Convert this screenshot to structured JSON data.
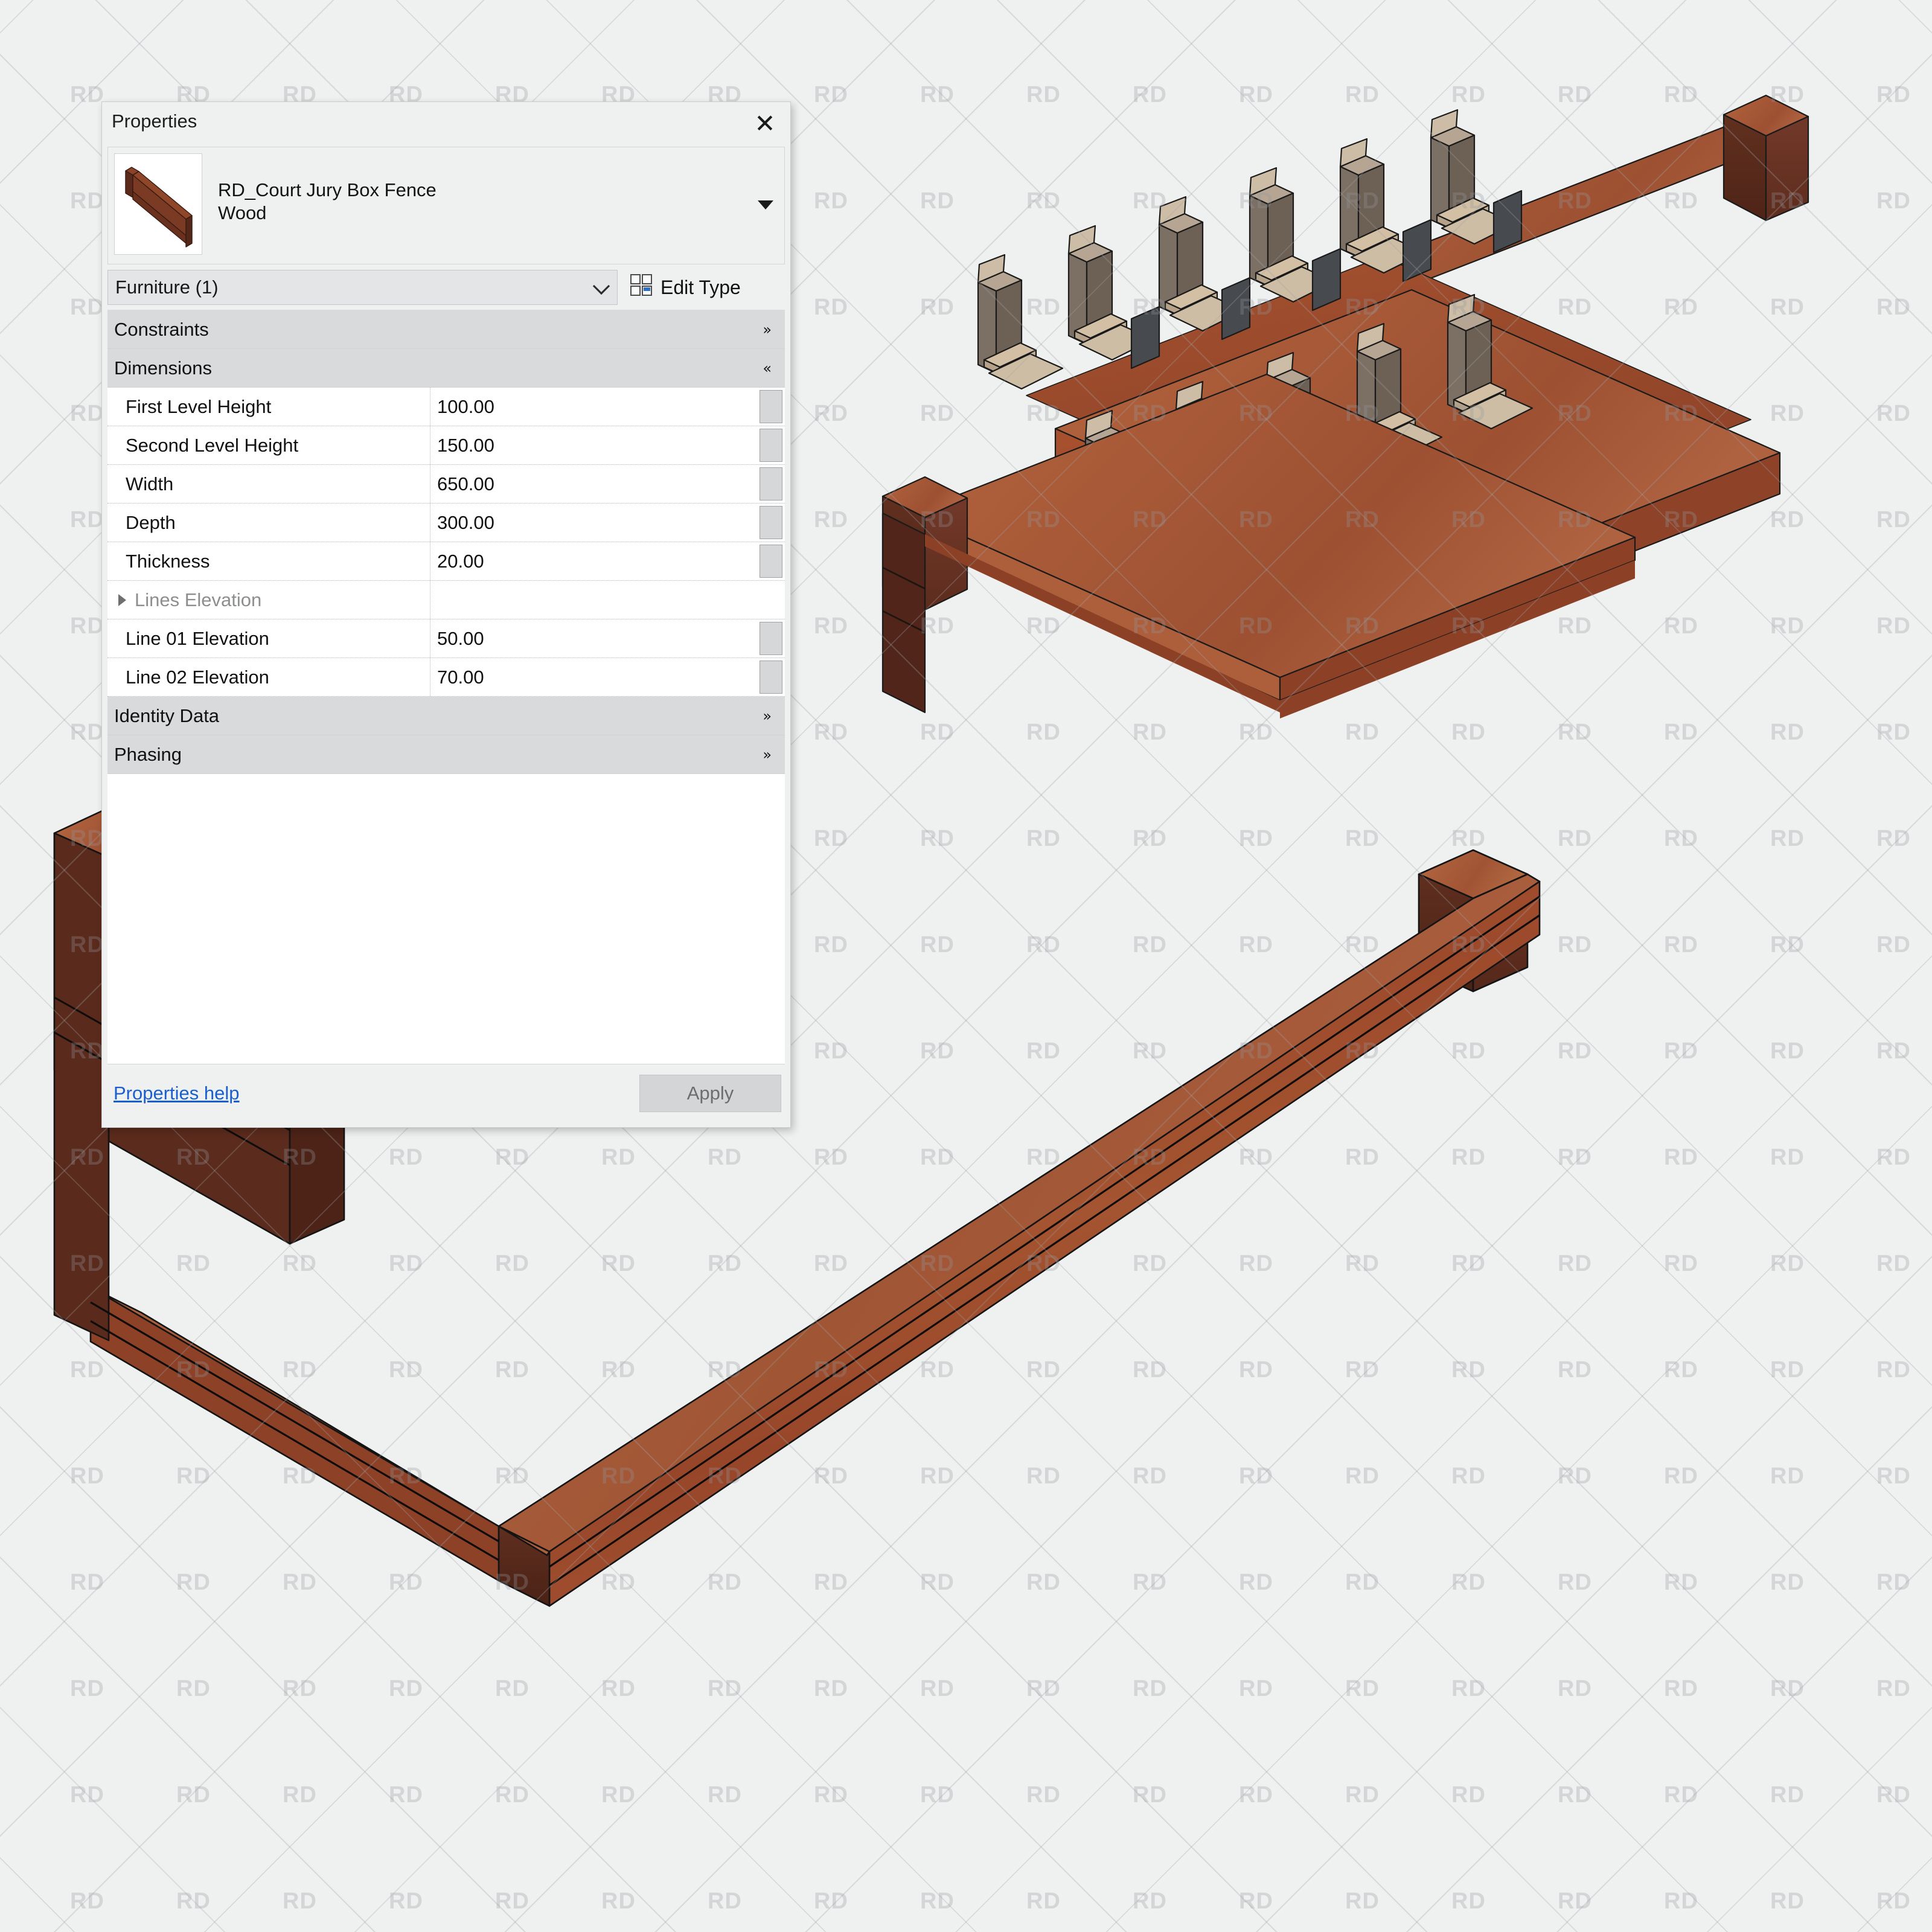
{
  "panel": {
    "title": "Properties",
    "close_icon": "close-icon",
    "family_name": "RD_Court Jury Box Fence",
    "type_name": "Wood",
    "type_caret_icon": "caret-down-icon",
    "category_value": "Furniture (1)",
    "category_chevron_icon": "chevron-down-icon",
    "edit_type_label": "Edit Type",
    "edit_type_icon": "edit-type-grid-icon",
    "help_link": "Properties help",
    "apply_label": "Apply",
    "sections": [
      {
        "label": "Constraints",
        "state": "collapsed",
        "chevron": "»"
      },
      {
        "label": "Dimensions",
        "state": "expanded",
        "chevron": "«"
      },
      {
        "label": "Identity Data",
        "state": "collapsed",
        "chevron": "»"
      },
      {
        "label": "Phasing",
        "state": "collapsed",
        "chevron": "»"
      }
    ],
    "rows": [
      {
        "name": "First Level Height",
        "value": "100.00",
        "sub": false
      },
      {
        "name": "Second Level Height",
        "value": "150.00",
        "sub": false
      },
      {
        "name": "Width",
        "value": "650.00",
        "sub": false
      },
      {
        "name": "Depth",
        "value": "300.00",
        "sub": false
      },
      {
        "name": "Thickness",
        "value": "20.00",
        "sub": false
      },
      {
        "name": "Lines Elevation",
        "value": "",
        "sub": true
      },
      {
        "name": "Line 01 Elevation",
        "value": "50.00",
        "sub": false
      },
      {
        "name": "Line 02 Elevation",
        "value": "70.00",
        "sub": false
      }
    ]
  },
  "viewport": {
    "background_color": "#eff0f0",
    "watermark_text": "RD",
    "models": [
      {
        "name": "jury-box-with-seating",
        "description": "3D isometric view of court jury box fence with two rows of seats"
      },
      {
        "name": "jury-box-fence-empty",
        "description": "3D isometric view of the U-shaped court jury box fence"
      }
    ],
    "colors": {
      "wood_top": "#ad5f3c",
      "wood_front": "#9e4c2f",
      "wood_dark": "#5b2a1c",
      "wood_mid": "#8b3f27",
      "seat_back": "#6d6054",
      "seat_cushion": "#cfbda4",
      "seat_arm": "#d8c5ab",
      "seat_panel": "#474b50",
      "outline": "#1a1a1a"
    }
  }
}
